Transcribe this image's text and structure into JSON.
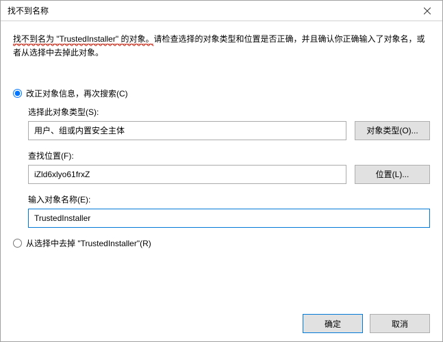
{
  "titlebar": {
    "title": "找不到名称"
  },
  "message": {
    "error_part": "找不到名为 \"TrustedInstaller\" 的对象。",
    "rest_part": "请检查选择的对象类型和位置是否正确，并且确认你正确输入了对象名，或者从选择中去掉此对象。"
  },
  "radio": {
    "option1_label": "改正对象信息，再次搜索(C)",
    "option2_label": "从选择中去掉 \"TrustedInstaller\"(R)"
  },
  "fields": {
    "object_type_label": "选择此对象类型(S):",
    "object_type_value": "用户、组或内置安全主体",
    "object_type_button": "对象类型(O)...",
    "location_label": "查找位置(F):",
    "location_value": "iZld6xlyo61frxZ",
    "location_button": "位置(L)...",
    "name_label": "输入对象名称(E):",
    "name_value": "TrustedInstaller"
  },
  "buttons": {
    "ok": "确定",
    "cancel": "取消"
  }
}
